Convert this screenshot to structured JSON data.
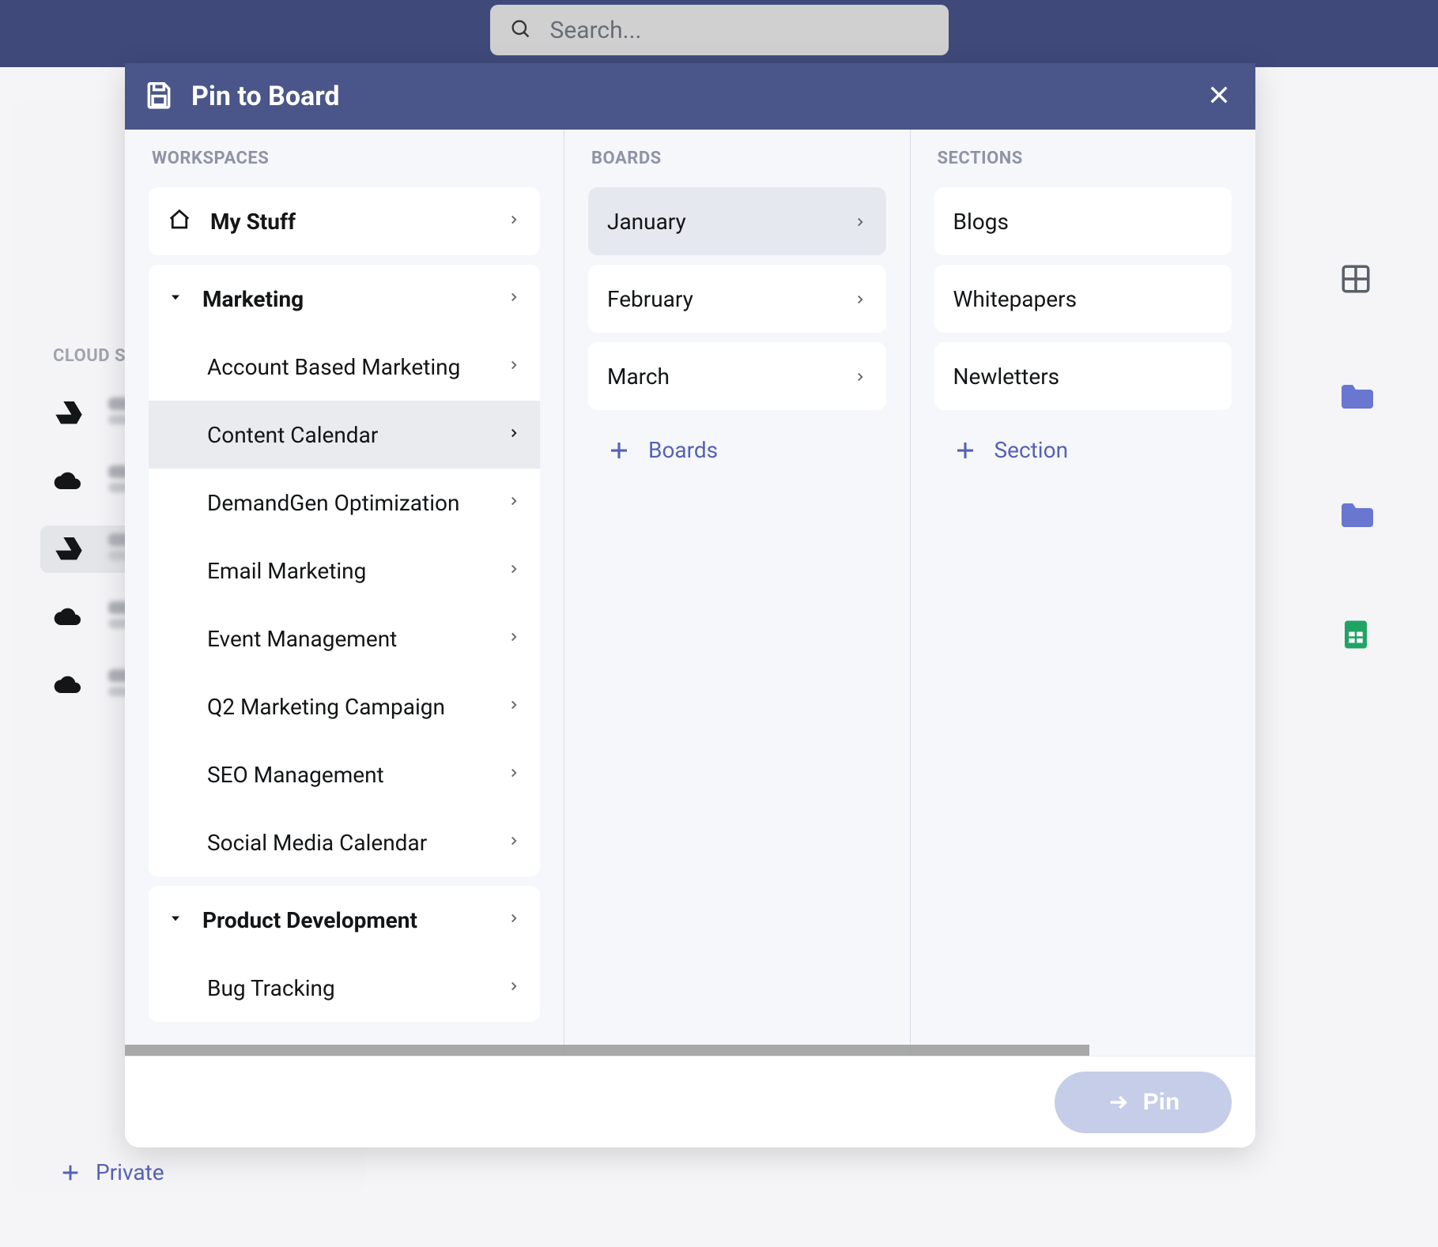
{
  "bg": {
    "search_placeholder": "Search...",
    "cloud_section_label": "CLOUD STORAGE",
    "add_private_label": "Private"
  },
  "modal": {
    "title": "Pin to Board",
    "columns": {
      "workspaces": "WORKSPACES",
      "boards": "BOARDS",
      "sections": "SECTIONS"
    },
    "workspaces": {
      "my_stuff": "My Stuff",
      "marketing": {
        "label": "Marketing",
        "items": [
          "Account Based Marketing",
          "Content Calendar",
          "DemandGen Optimization",
          "Email Marketing",
          "Event Management",
          "Q2 Marketing Campaign",
          "SEO Management",
          "Social Media Calendar"
        ],
        "selected_index": 1
      },
      "product_dev": {
        "label": "Product Development",
        "items": [
          "Bug Tracking"
        ]
      }
    },
    "boards": {
      "items": [
        "January",
        "February",
        "March"
      ],
      "selected_index": 0,
      "add_label": "Boards"
    },
    "sections": {
      "items": [
        "Blogs",
        "Whitepapers",
        "Newletters"
      ],
      "add_label": "Section"
    },
    "pin_btn": "Pin"
  }
}
